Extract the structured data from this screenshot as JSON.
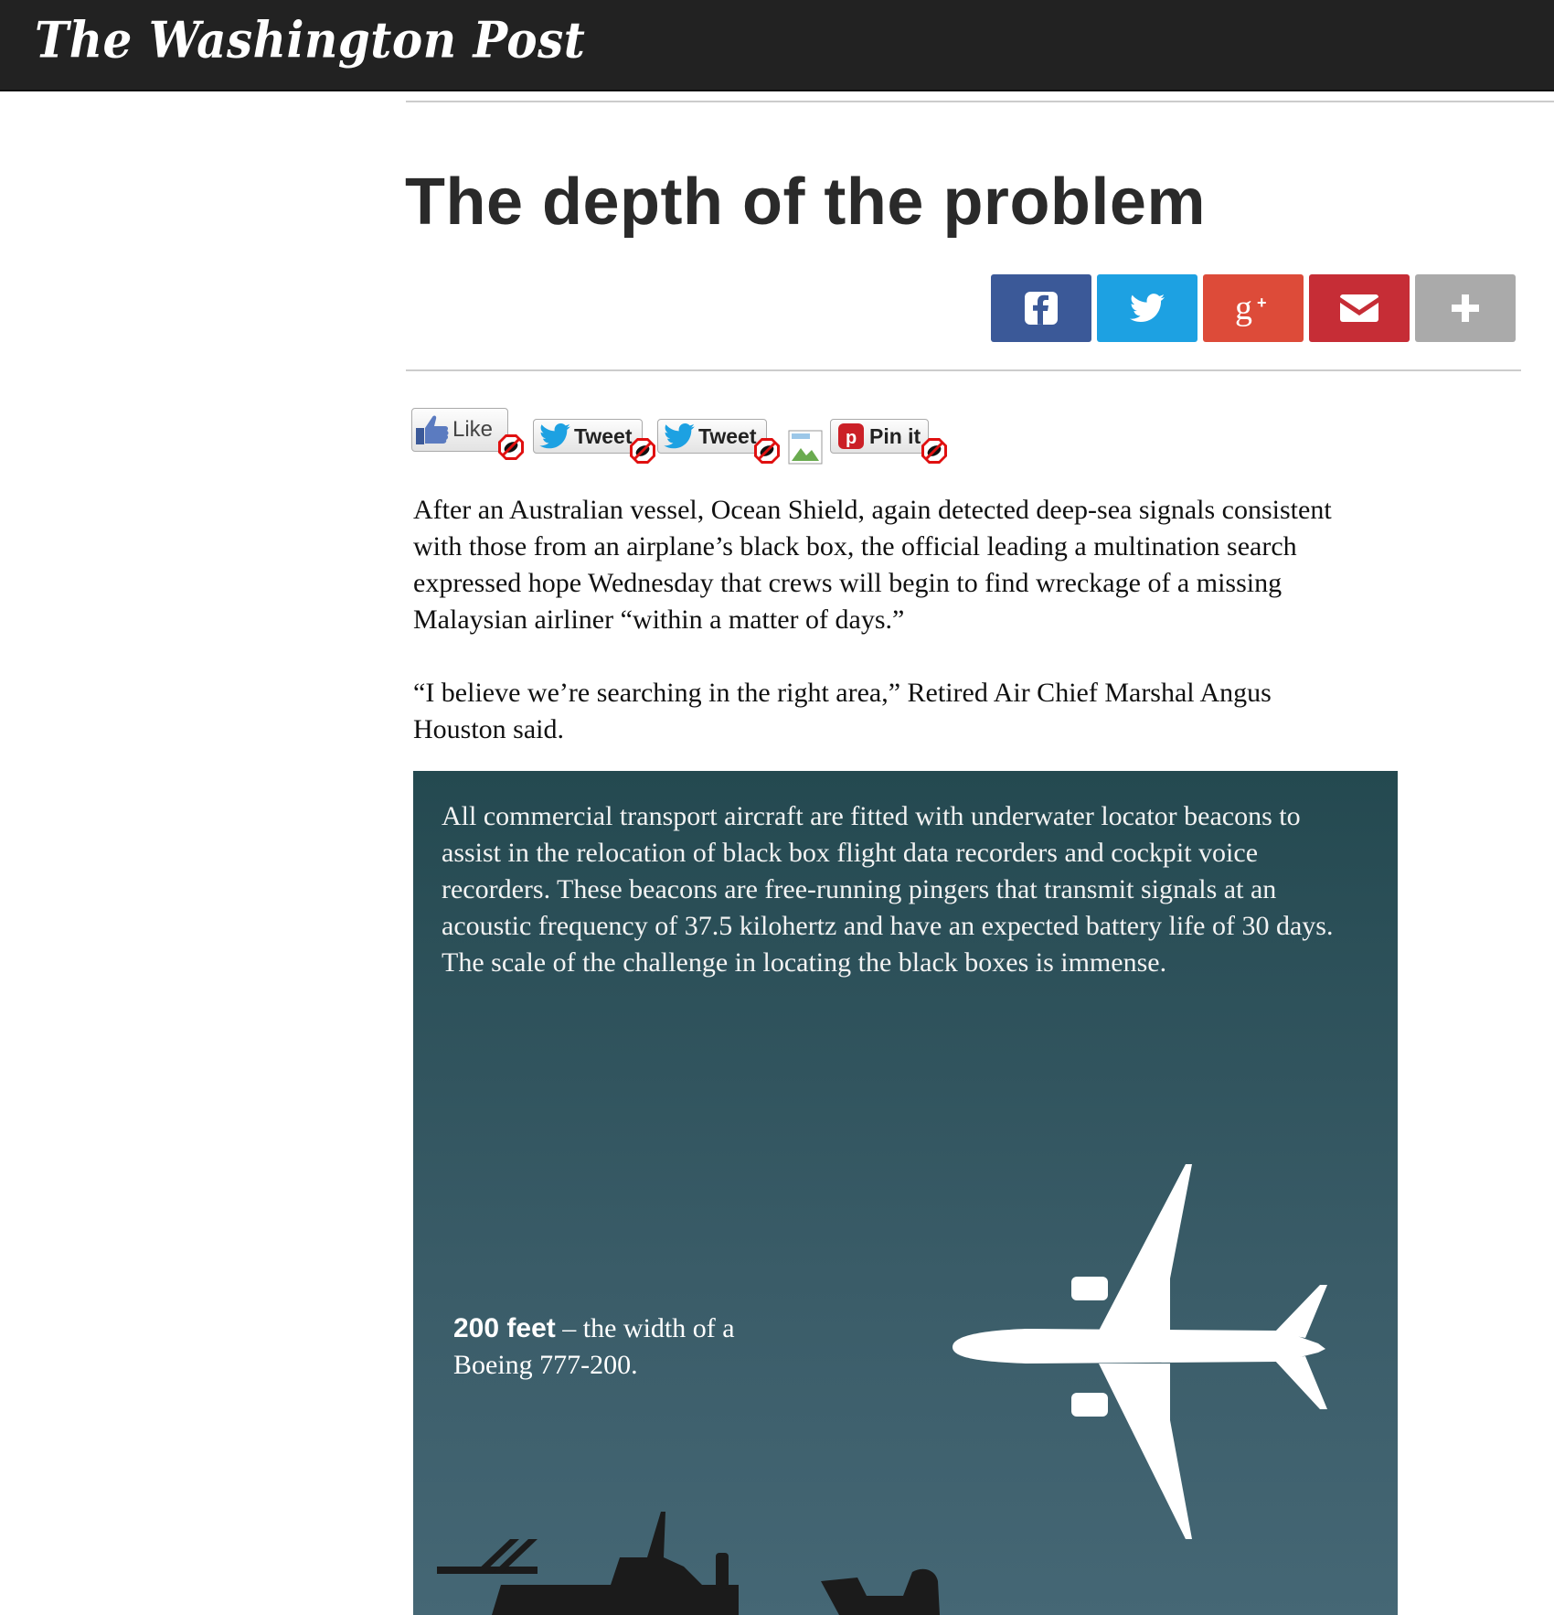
{
  "masthead": {
    "logo_text": "The Washington Post"
  },
  "article": {
    "headline": "The depth of the problem",
    "paragraphs": [
      "After an Australian vessel, Ocean Shield, again detected deep-sea signals consistent with those from an airplane’s black box, the official leading a multination search expressed hope Wednesday that crews will begin to find wreckage of a missing Malaysian airliner “within a matter of days.”",
      "“I believe we’re searching in the right area,” Retired Air Chief Marshal Angus Houston said."
    ]
  },
  "share": {
    "buttons": [
      {
        "name": "facebook",
        "icon": "facebook-icon",
        "color": "#3b5998"
      },
      {
        "name": "twitter",
        "icon": "twitter-icon",
        "color": "#1da1e2"
      },
      {
        "name": "googleplus",
        "icon": "google-plus-icon",
        "color": "#dd4b39"
      },
      {
        "name": "email",
        "icon": "envelope-icon",
        "color": "#c62d36"
      },
      {
        "name": "more",
        "icon": "plus-icon",
        "color": "#aaaaaa"
      }
    ]
  },
  "social_widgets": {
    "like_label": "Like",
    "tweet_label": "Tweet",
    "tweet2_label": "Tweet",
    "pin_label": "Pin it"
  },
  "graphic": {
    "intro": "All commercial transport aircraft are fitted with underwater locator beacons to assist in the relocation of black box flight data recorders and cockpit voice recorders. These beacons are free-running pingers that transmit signals at an acoustic frequency of 37.5 kilohertz and have an expected battery life of 30 days. The scale of the challenge in locating the black boxes is immense.",
    "caption_bold": "200 feet",
    "caption_rest": " – the width of a Boeing 777-200."
  }
}
